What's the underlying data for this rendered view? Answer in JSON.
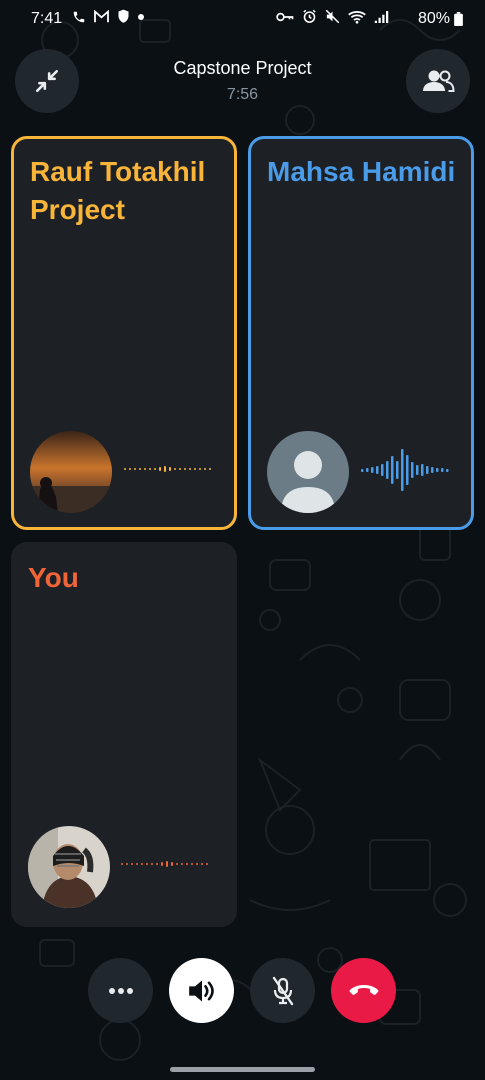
{
  "status_bar": {
    "time": "7:41",
    "left_icons": [
      "phone-icon",
      "gmail-icon",
      "shield-icon",
      "dot-icon"
    ],
    "right_icons": [
      "key-icon",
      "alarm-icon",
      "mute-icon",
      "wifi-icon",
      "signal-icon"
    ],
    "battery": "80%"
  },
  "header": {
    "title": "Capstone Project",
    "timer": "7:56",
    "left_button_icon": "minimize-icon",
    "right_button_icon": "participants-icon"
  },
  "tiles": [
    {
      "name": "Rauf Totakhil Project",
      "color": "#f9b43a",
      "speaking": false
    },
    {
      "name": "Mahsa Hamidi",
      "color": "#4a9be8",
      "speaking": true
    },
    {
      "name": "You",
      "color": "#f06438",
      "speaking": false
    }
  ],
  "controls": [
    "more-icon",
    "speaker-icon",
    "mic-off-icon",
    "end-call-icon"
  ],
  "colors": {
    "background": "#0b1014",
    "tile_bg": "#1d2125",
    "end_call": "#ea1a47"
  }
}
